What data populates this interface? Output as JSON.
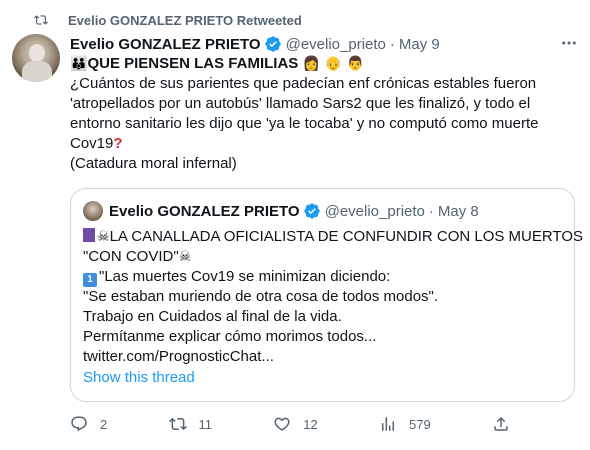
{
  "retweet": {
    "label": "Evelio GONZALEZ PRIETO Retweeted"
  },
  "tweet": {
    "author_name": "Evelio GONZALEZ PRIETO",
    "handle": "@evelio_prieto",
    "separator": "·",
    "date": "May 9",
    "heading": "QUE PIENSEN LAS FAMILIAS",
    "lines": [
      "¿Cuántos de sus parientes que padecían enf crónicas estables fueron",
      "'atropellados por un autobús' llamado Sars2 que les finalizó, y todo el",
      "entorno sanitario les dijo que 'ya le tocaba' y no computó como muerte",
      "Cov19",
      "(Catadura moral infernal)"
    ]
  },
  "quote": {
    "author_name": "Evelio GONZALEZ PRIETO",
    "handle": "@evelio_prieto",
    "separator": "·",
    "date": "May 8",
    "line1": "LA CANALLADA OFICIALISTA DE CONFUNDIR CON LOS MUERTOS",
    "line2": "\"CON COVID\"",
    "line3": "\"Las muertes Cov19 se minimizan diciendo:",
    "line4": "\"Se estaban muriendo de otra cosa de todos modos\".",
    "line5": "Trabajo en Cuidados al final de la vida.",
    "line6": "Permítanme explicar cómo morimos todos...",
    "line7": "twitter.com/PrognosticChat...",
    "keycap": "1",
    "show_thread": "Show this thread"
  },
  "actions": {
    "replies": "2",
    "retweets": "11",
    "likes": "12",
    "views": "579"
  },
  "colors": {
    "accent": "#1d9bf0",
    "secondary_text": "#536471",
    "border": "#cfd9de"
  }
}
